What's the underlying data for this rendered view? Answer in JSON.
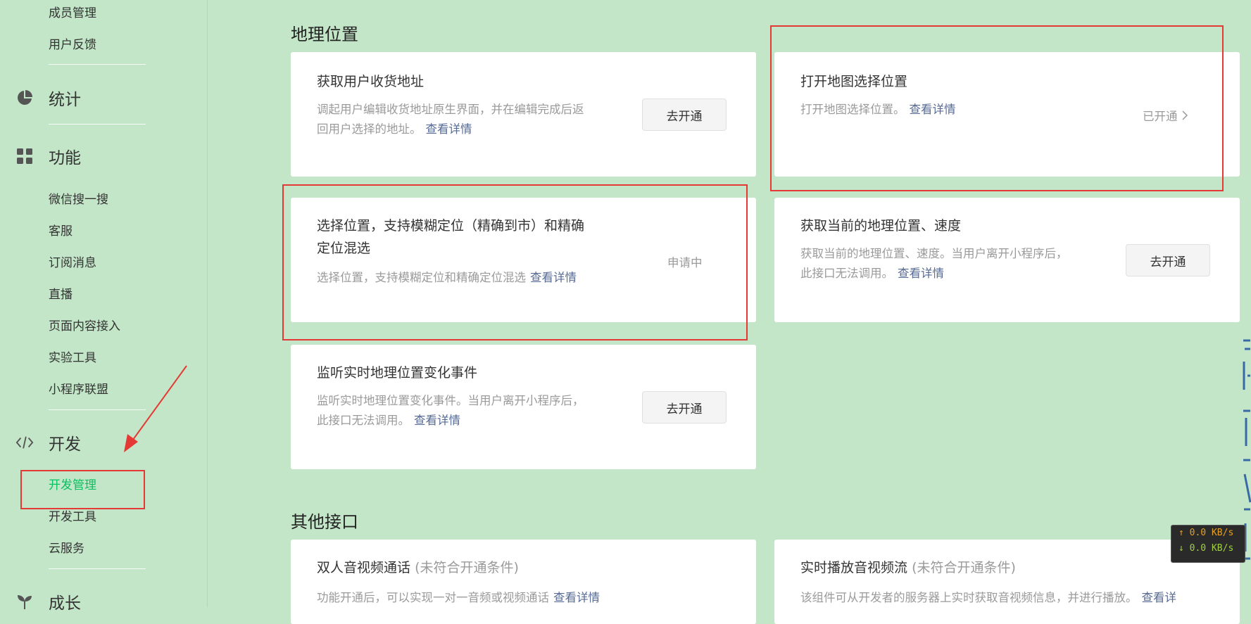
{
  "sidebar": {
    "top_items": [
      "成员管理",
      "用户反馈"
    ],
    "groups": {
      "stats": "统计",
      "features": "功能",
      "dev": "开发",
      "growth": "成长"
    },
    "feature_items": [
      "微信搜一搜",
      "客服",
      "订阅消息",
      "直播",
      "页面内容接入",
      "实验工具",
      "小程序联盟"
    ],
    "dev_items": [
      "开发管理",
      "开发工具",
      "云服务"
    ]
  },
  "sections": {
    "geo_title": "地理位置",
    "other_title": "其他接口"
  },
  "cards": {
    "address": {
      "title": "获取用户收货地址",
      "desc_line1": "调起用户编辑收货地址原生界面，并在编辑完成后返",
      "desc_line2": "回用户选择的地址。",
      "link": "查看详情",
      "button": "去开通"
    },
    "map": {
      "title": "打开地图选择位置",
      "desc": "打开地图选择位置。",
      "link": "查看详情",
      "status": "已开通"
    },
    "choose": {
      "title_line1": "选择位置，支持模糊定位（精确到市）和精确",
      "title_line2": "定位混选",
      "desc": "选择位置，支持模糊定位和精确定位混选",
      "link": "查看详情",
      "status": "申请中"
    },
    "current": {
      "title": "获取当前的地理位置、速度",
      "desc_line1": "获取当前的地理位置、速度。当用户离开小程序后，",
      "desc_line2": "此接口无法调用。",
      "link": "查看详情",
      "button": "去开通"
    },
    "listen": {
      "title": "监听实时地理位置变化事件",
      "desc_line1": "监听实时地理位置变化事件。当用户离开小程序后，",
      "desc_line2": "此接口无法调用。",
      "link": "查看详情",
      "button": "去开通"
    },
    "call": {
      "title": "双人音视频通话",
      "note": "(未符合开通条件)",
      "desc": "功能开通后，可以实现一对一音频或视频通话",
      "link": "查看详情"
    },
    "stream": {
      "title": "实时播放音视频流",
      "note": "(未符合开通条件)",
      "desc": "该组件可从开发者的服务器上实时获取音视频信息，并进行播放。",
      "link": "查看详"
    }
  },
  "netspeed": {
    "up": "0.0 KB/s",
    "down": "0.0 KB/s"
  },
  "colors": {
    "background": "#c2e6c7",
    "active": "#07c160",
    "link": "#576b95",
    "highlight": "#e53935"
  }
}
